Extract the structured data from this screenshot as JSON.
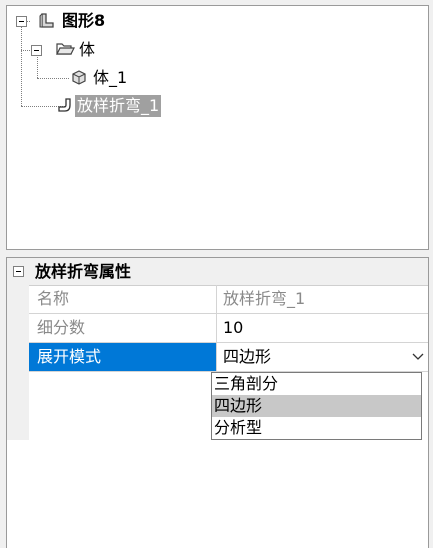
{
  "tree": {
    "root": {
      "label": "图形8"
    },
    "group": {
      "label": "体"
    },
    "body_item": {
      "label": "体_1"
    },
    "loft_item": {
      "label": "放样折弯_1"
    }
  },
  "properties": {
    "header": "放样折弯属性",
    "rows": [
      {
        "name": "名称",
        "value": "放样折弯_1"
      },
      {
        "name": "细分数",
        "value": "10"
      },
      {
        "name": "展开模式",
        "value": "四边形"
      }
    ],
    "dropdown_options": [
      "三角剖分",
      "四边形",
      "分析型"
    ],
    "selected_option": "四边形"
  },
  "colors": {
    "selection": "#0078d7",
    "tree_selection": "#a0a0a0"
  }
}
